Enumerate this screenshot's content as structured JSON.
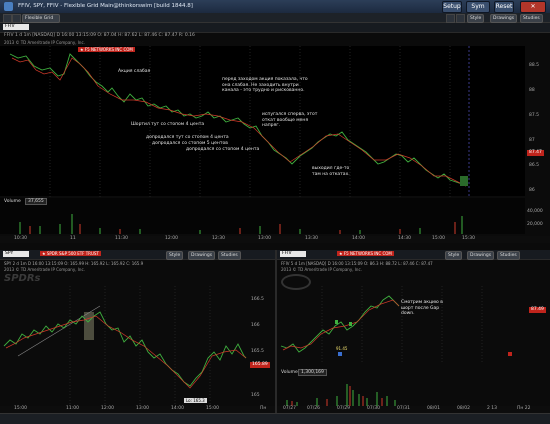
{
  "window": {
    "title": "FFIV, SPY, FFIV - Flexible Grid Main@thinkorswim [build 1844.8]",
    "buttons": [
      "Setup",
      "Sym",
      "Reset"
    ]
  },
  "toolbar": {
    "grid_label": "Flexible Grid"
  },
  "top_chart": {
    "symbol": "FFIV",
    "style_label": "Style",
    "drawings_label": "Drawings",
    "studies_label": "Studies",
    "header": "FFIV 1 d 1m [NASDAQ]  D 16:00 13:15:09  O: 87.04  H: 87.62  L: 87.46  C: 87.47  R: 0.16",
    "copyright": "2013 © TD Ameritrade IP Company, Inc.",
    "banner": "★ F5 NETWORKS INC COM",
    "price_ticks": [
      "88.5",
      "88",
      "87.5",
      "87",
      "86.5",
      "86"
    ],
    "time_ticks": [
      "10:30",
      "11",
      "11:30",
      "12:00",
      "12:30",
      "13:00",
      "13:30",
      "14:00",
      "14:30",
      "15:00",
      "15:30",
      "15:4"
    ],
    "current_price": "87.47",
    "volume_label": "Volume",
    "volume_value": "37,655",
    "volume_ticks": [
      "40,000",
      "20,000"
    ],
    "annotations": [
      "Акция слабая",
      "перед заходом акция показала, что она слабая. Не заходить внутри канала - это трудно и рискованно.",
      "Шортил тут со стопом 4 цента",
      "испугался сперва, этот откат вообще меня напряг.",
      "допродался тут со стопом 4 цента",
      "допродался со стопом 5 центов",
      "допродался со стопом 4 цента",
      "выходил где-то там на откатах."
    ]
  },
  "left_chart": {
    "symbol": "SPY",
    "banner": "★ SPDR S&P 500 ETF TRUST",
    "style_label": "Style",
    "drawings_label": "Drawings",
    "studies_label": "Studies",
    "header": "SPY 2 d 1m  D 16:00 13:15:09  O: 165.99  H: 165.92  L: 165.92  C: 165.9",
    "copyright": "2013 © TD Ameritrade IP Company, Inc.",
    "watermark": "SPDRs",
    "current_price": "165.89",
    "price_ticks": [
      "166.5",
      "166",
      "165.5",
      "165"
    ],
    "low_label": "Lo: 165.3",
    "time_ticks": [
      "15:00",
      "11:00",
      "12:00",
      "13:00",
      "14:00",
      "15:00",
      "Пн"
    ]
  },
  "right_chart": {
    "symbol": "FFIV",
    "banner": "★ F5 NETWORKS INC COM",
    "style_label": "Style",
    "drawings_label": "Drawings",
    "studies_label": "Studies",
    "header": "FFIV 5 d 1m [NASDAQ]  D 16:00 13:15:09  O: 86.3  H: 88.72  L: 87.46  C: 87.47",
    "copyright": "2013 © TD Ameritrade IP Company, Inc.",
    "current_price": "87.49",
    "annotation": "Смотрим акцию в шорт после Gap down.",
    "marker_label": "91.45",
    "volume_label": "Volume",
    "volume_value": "1,300,169",
    "time_ticks": [
      "07/27",
      "07/26",
      "07/29",
      "07/30",
      "07/31",
      "08/01",
      "08/02",
      "2 13",
      "Пн 22"
    ]
  }
}
